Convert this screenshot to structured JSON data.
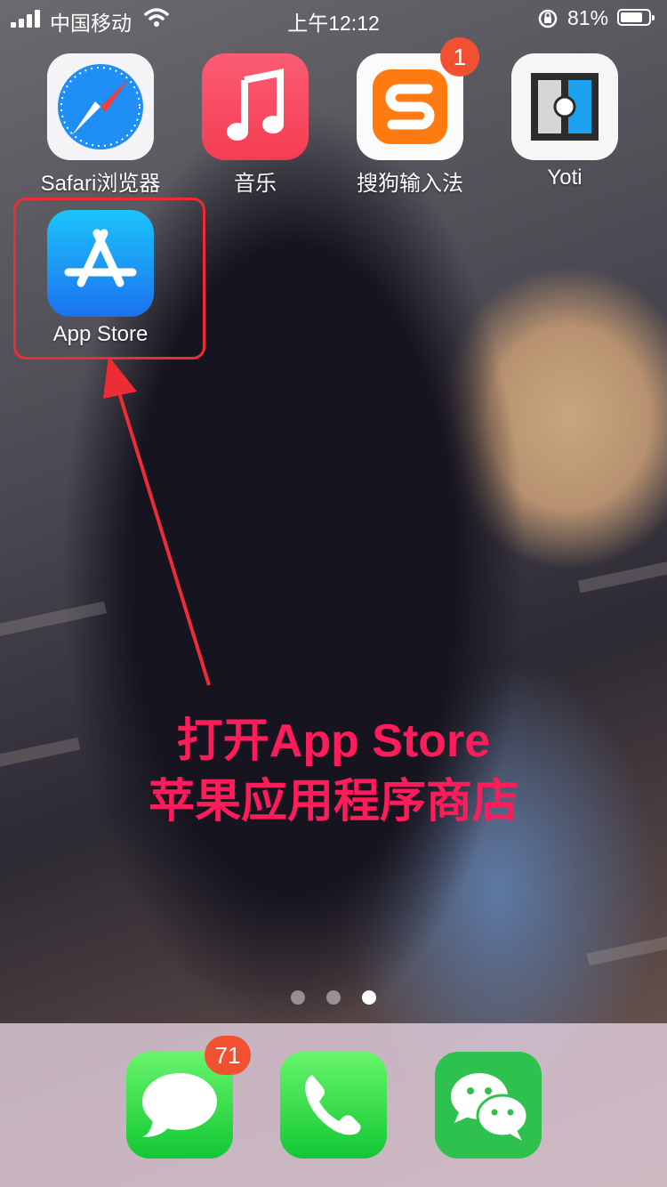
{
  "status_bar": {
    "carrier": "中国移动",
    "time": "上午12:12",
    "battery_percent_text": "81%",
    "battery_level": 0.81
  },
  "apps": [
    {
      "label": "Safari浏览器",
      "icon": "safari-compass-icon"
    },
    {
      "label": "音乐",
      "icon": "music-note-icon"
    },
    {
      "label": "搜狗输入法",
      "icon": "sogou-s-icon",
      "badge": "1"
    },
    {
      "label": "Yoti",
      "icon": "yoti-icon"
    },
    {
      "label": "App Store",
      "icon": "app-store-a-icon"
    }
  ],
  "annotation": {
    "line1": "打开App Store",
    "line2": "苹果应用程序商店",
    "color": "#ff1c5a"
  },
  "page_dots": {
    "count": 3,
    "active": 3
  },
  "dock": [
    {
      "app": "messages",
      "icon": "messages-bubble-icon",
      "badge": "71"
    },
    {
      "app": "phone",
      "icon": "phone-handset-icon"
    },
    {
      "app": "wechat",
      "icon": "wechat-bubbles-icon"
    }
  ]
}
